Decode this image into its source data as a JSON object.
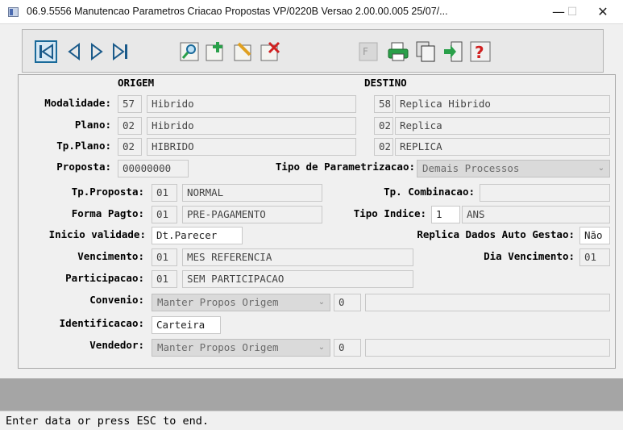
{
  "window": {
    "title": "06.9.5556 Manutencao Parametros Criacao Propostas VP/0220B Versao 2.00.00.005 25/07/...",
    "minimize": "—",
    "maximize": "☐",
    "close": "✕"
  },
  "toolbar": {
    "buttons": [
      {
        "icon": "first-record-icon"
      },
      {
        "icon": "previous-record-icon"
      },
      {
        "icon": "next-record-icon"
      },
      {
        "icon": "last-record-icon"
      },
      {
        "icon": "search-icon"
      },
      {
        "icon": "add-icon"
      },
      {
        "icon": "edit-icon"
      },
      {
        "icon": "delete-icon"
      },
      {
        "icon": "filter-icon"
      },
      {
        "icon": "print-icon"
      },
      {
        "icon": "copy-icon"
      },
      {
        "icon": "exit-icon"
      },
      {
        "icon": "help-icon"
      }
    ]
  },
  "form": {
    "origem_header": "ORIGEM",
    "destino_header": "DESTINO",
    "modalidade": {
      "label": "Modalidade:",
      "orig_code": "57",
      "orig_desc": "Hibrido",
      "dest_code": "58",
      "dest_desc": "Replica Hibrido"
    },
    "plano": {
      "label": "Plano:",
      "orig_code": "02",
      "orig_desc": "Hibrido",
      "dest_code": "02",
      "dest_desc": "Replica"
    },
    "tp_plano": {
      "label": "Tp.Plano:",
      "orig_code": "02",
      "orig_desc": "HIBRIDO",
      "dest_code": "02",
      "dest_desc": "REPLICA"
    },
    "proposta": {
      "label": "Proposta:",
      "value": "00000000"
    },
    "tipo_parametrizacao": {
      "label": "Tipo de Parametrizacao:",
      "value": "Demais Processos"
    },
    "tp_proposta": {
      "label": "Tp.Proposta:",
      "code": "01",
      "desc": "NORMAL"
    },
    "tp_combinacao": {
      "label": "Tp. Combinacao:",
      "value": ""
    },
    "forma_pagto": {
      "label": "Forma Pagto:",
      "code": "01",
      "desc": "PRE-PAGAMENTO"
    },
    "tipo_indice": {
      "label": "Tipo Indice:",
      "code": "1",
      "desc": "ANS"
    },
    "inicio_validade": {
      "label": "Inicio validade:",
      "value": "Dt.Parecer"
    },
    "replica_dados": {
      "label": "Replica Dados Auto Gestao:",
      "value": "Não"
    },
    "vencimento": {
      "label": "Vencimento:",
      "code": "01",
      "desc": "MES REFERENCIA"
    },
    "dia_vencimento": {
      "label": "Dia Vencimento:",
      "value": "01"
    },
    "participacao": {
      "label": "Participacao:",
      "code": "01",
      "desc": "SEM PARTICIPACAO"
    },
    "convenio": {
      "label": "Convenio:",
      "select": "Manter Propos Origem",
      "code": "0",
      "desc": ""
    },
    "identificacao": {
      "label": "Identificacao:",
      "value": "Carteira"
    },
    "vendedor": {
      "label": "Vendedor:",
      "select": "Manter Propos Origem",
      "code": "0",
      "desc": ""
    }
  },
  "status": {
    "message": "Enter data or press ESC to end."
  }
}
